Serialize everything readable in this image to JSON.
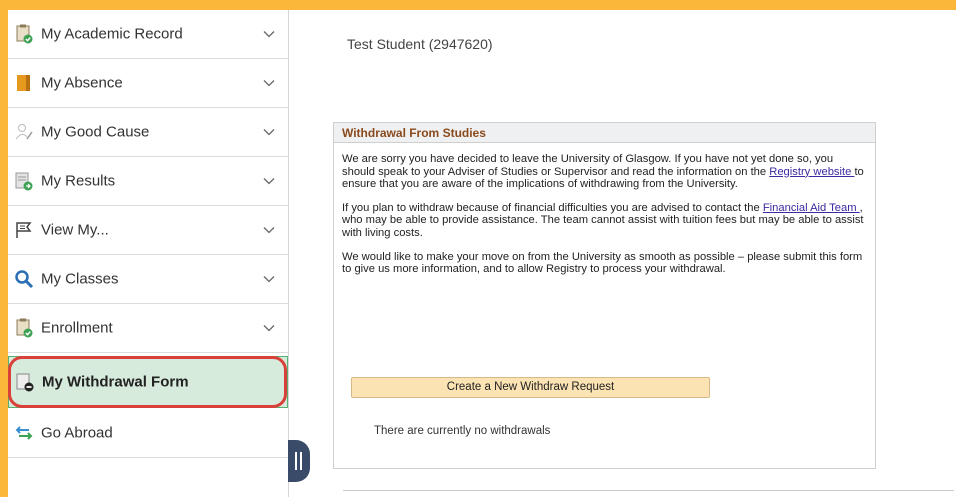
{
  "sidebar": {
    "items": [
      {
        "label": "My Academic Record",
        "icon": "document-check-icon"
      },
      {
        "label": "My Absence",
        "icon": "folder-book-icon"
      },
      {
        "label": "My Good Cause",
        "icon": "person-pen-icon"
      },
      {
        "label": "My Results",
        "icon": "results-icon"
      },
      {
        "label": "View My...",
        "icon": "flag-icon"
      },
      {
        "label": "My Classes",
        "icon": "search-icon"
      },
      {
        "label": "Enrollment",
        "icon": "clipboard-check-icon"
      },
      {
        "label": "My Withdrawal Form",
        "icon": "withdrawal-form-icon"
      },
      {
        "label": "Go Abroad",
        "icon": "arrows-exchange-icon"
      }
    ]
  },
  "student": {
    "name": "Test Student (2947620)"
  },
  "panel": {
    "title": "Withdrawal From Studies",
    "p1_a": "We are sorry you have decided to leave the University of Glasgow. If you have not yet done so, you should speak to your Adviser of Studies or Supervisor and read the information on the ",
    "p1_link": "Registry website ",
    "p1_b": "to ensure that you are aware of the implications of withdrawing from the University.",
    "p2_a": "If you plan to withdraw because of financial difficulties you are advised to contact the ",
    "p2_link": "Financial Aid Team ",
    "p2_b": ", who may be able to provide assistance. The team cannot assist with tuition fees but may be able to assist with living costs.",
    "p3": "We would like to make your move on from the University as smooth as possible – please submit this form to give us more information, and to allow Registry to process your withdrawal.",
    "create_button": "Create a New Withdraw Request",
    "no_withdrawals": "There are currently no withdrawals"
  },
  "colors": {
    "accent_border": "#fbb73a",
    "active_bg": "#d7ebdd",
    "highlight": "#d9403a",
    "panel_title": "#8a4a1c"
  }
}
